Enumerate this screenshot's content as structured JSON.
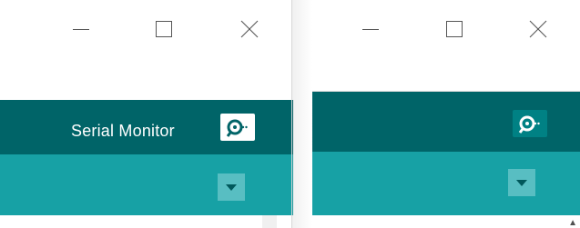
{
  "windows": {
    "left": {
      "toolbar": {
        "serial_monitor_label": "Serial Monitor"
      },
      "icons": {
        "minimize": "minimize-icon",
        "maximize": "maximize-icon",
        "close": "close-icon",
        "serial_monitor": "serial-monitor-icon",
        "dropdown": "dropdown-arrow-icon"
      }
    },
    "right": {
      "icons": {
        "minimize": "minimize-icon",
        "maximize": "maximize-icon",
        "close": "close-icon",
        "serial_monitor": "serial-monitor-icon",
        "dropdown": "dropdown-arrow-icon",
        "scroll_up": "scroll-up-arrow-icon"
      }
    }
  },
  "colors": {
    "toolbar": "#006468",
    "tabbar": "#17a1a5",
    "dropdown_button": "#58bec2",
    "window_bg": "#ffffff"
  }
}
